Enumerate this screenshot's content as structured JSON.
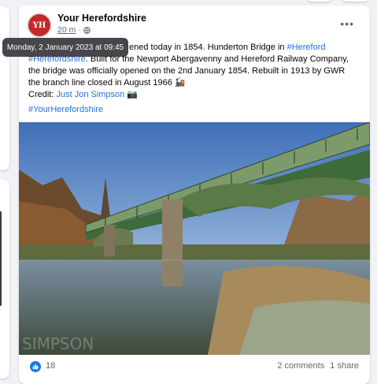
{
  "post": {
    "page_name": "Your Herefordshire",
    "avatar_text": "YH",
    "timestamp": "20 m",
    "tooltip": "Monday, 2 January 2023 at 09:45",
    "text_part1": "ened today in 1854. Hunderton Bridge in ",
    "text_link1": "#Hereford",
    "text_part2": "#Herefordshire",
    "text_part3": ". Built for the Newport Abergavenny and Hereford Railway Company, the bridge was officially opened on the 2nd January 1854. Rebuilt in 1913 by GWR the branch line closed in August 1966 🚂",
    "credit_label": "Credit: ",
    "credit_name": "Just Jon Simpson",
    "credit_icon": "📷",
    "hashtag": "#YourHerefordshire",
    "more_icon": "•••",
    "photo_watermark": "SIMPSON",
    "likes": "18",
    "comments": "2 comments",
    "shares": "1 share"
  },
  "colors": {
    "link": "#216fdb",
    "like": "#1877f2"
  }
}
